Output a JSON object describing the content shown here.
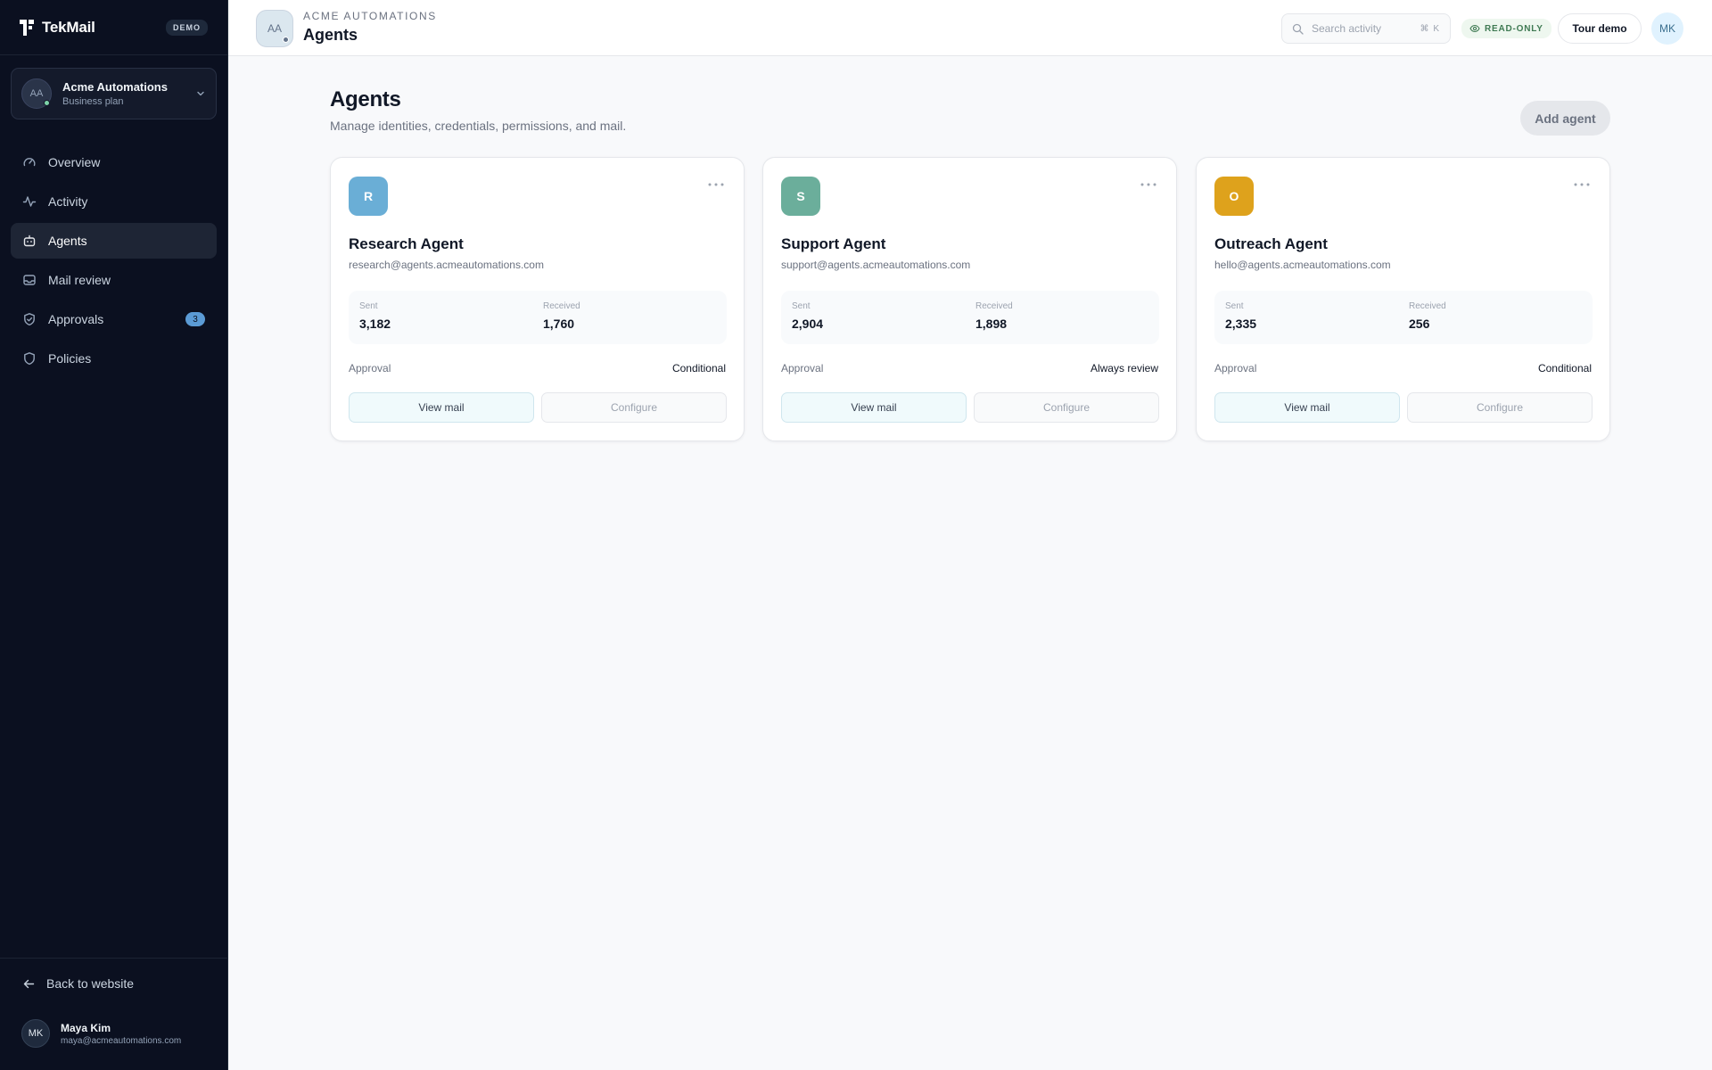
{
  "brand": {
    "name": "TekMail",
    "badge": "DEMO"
  },
  "org": {
    "initials": "AA",
    "name": "Acme Automations",
    "plan": "Business plan"
  },
  "nav": [
    {
      "label": "Overview",
      "icon": "gauge-icon",
      "active": false
    },
    {
      "label": "Activity",
      "icon": "pulse-icon",
      "active": false
    },
    {
      "label": "Agents",
      "icon": "robot-icon",
      "active": true
    },
    {
      "label": "Mail review",
      "icon": "inbox-icon",
      "active": false
    },
    {
      "label": "Approvals",
      "icon": "shield-check-icon",
      "active": false,
      "badge": "3"
    },
    {
      "label": "Policies",
      "icon": "shield-icon",
      "active": false
    }
  ],
  "sidebar_footer": {
    "back_label": "Back to website",
    "user": {
      "initials": "MK",
      "name": "Maya Kim",
      "email": "maya@acmeautomations.com"
    }
  },
  "topbar": {
    "org_initials": "AA",
    "org_name": "ACME AUTOMATIONS",
    "title": "Agents",
    "search_placeholder": "Search activity",
    "search_shortcut": "⌘ K",
    "readonly_label": "READ-ONLY",
    "tour_label": "Tour demo",
    "user_initials": "MK"
  },
  "main": {
    "heading": "Agents",
    "subheading": "Manage identities, credentials, permissions, and mail.",
    "add_label": "Add agent"
  },
  "agents": [
    {
      "initial": "R",
      "color": "#6aaed6",
      "name": "Research Agent",
      "email": "research@agents.acmeautomations.com",
      "sent_label": "Sent",
      "sent": "3,182",
      "received_label": "Received",
      "received": "1,760",
      "approval_label": "Approval",
      "approval": "Conditional",
      "view_label": "View mail",
      "config_label": "Configure"
    },
    {
      "initial": "S",
      "color": "#6bae9b",
      "name": "Support Agent",
      "email": "support@agents.acmeautomations.com",
      "sent_label": "Sent",
      "sent": "2,904",
      "received_label": "Received",
      "received": "1,898",
      "approval_label": "Approval",
      "approval": "Always review",
      "view_label": "View mail",
      "config_label": "Configure"
    },
    {
      "initial": "O",
      "color": "#dea21c",
      "name": "Outreach Agent",
      "email": "hello@agents.acmeautomations.com",
      "sent_label": "Sent",
      "sent": "2,335",
      "received_label": "Received",
      "received": "256",
      "approval_label": "Approval",
      "approval": "Conditional",
      "view_label": "View mail",
      "config_label": "Configure"
    }
  ]
}
